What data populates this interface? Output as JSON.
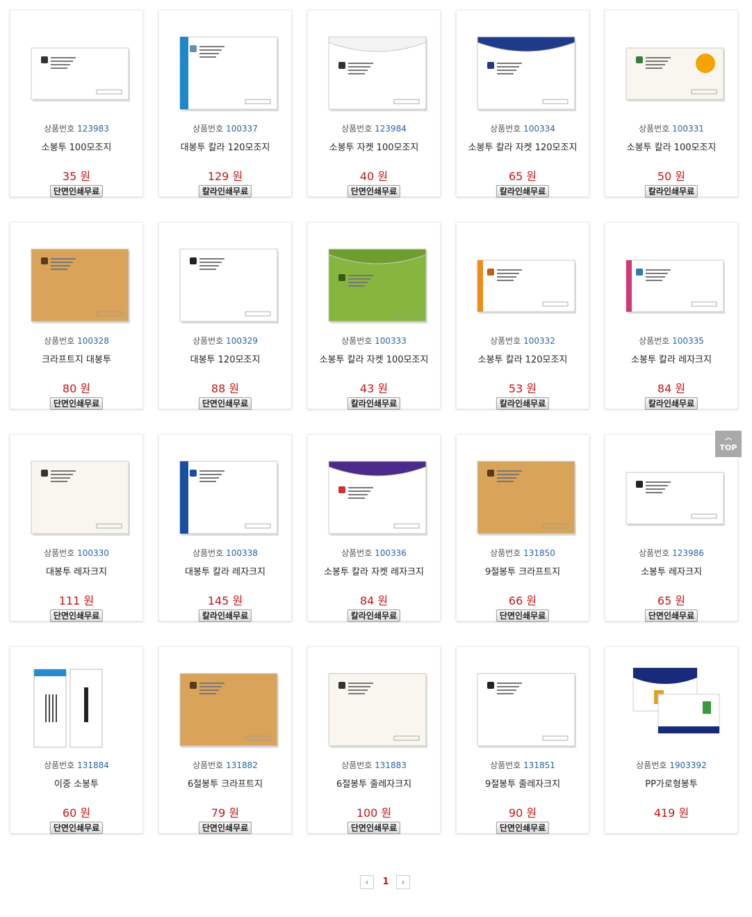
{
  "labels": {
    "product_no": "상품번호",
    "currency": "원"
  },
  "colors": {
    "price": "#c81414",
    "code": "#2a62a8",
    "top_button": "#a9a9a9"
  },
  "products": [
    {
      "code": "123983",
      "name": "소봉투 100모조지",
      "price": "35 원",
      "badge": "단면인쇄무료",
      "thumb": {
        "kind": "white",
        "shape": "small",
        "accent": "#888888",
        "logo": "#333333"
      }
    },
    {
      "code": "100337",
      "name": "대봉투 칼라 120모조지",
      "price": "129 원",
      "badge": "칼라인쇄무료",
      "thumb": {
        "kind": "color",
        "shape": "large",
        "accent": "#1e88c8",
        "logo": "#6b8fa8"
      }
    },
    {
      "code": "123984",
      "name": "소봉투 자켓 100모조지",
      "price": "40 원",
      "badge": "단면인쇄무료",
      "thumb": {
        "kind": "white",
        "shape": "flap",
        "accent": "#888888",
        "logo": "#333333"
      }
    },
    {
      "code": "100334",
      "name": "소봉투 칼라 자켓 120모조지",
      "price": "65 원",
      "badge": "칼라인쇄무료",
      "thumb": {
        "kind": "color",
        "shape": "flap",
        "accent": "#1f3a8a",
        "logo": "#1f3a8a"
      }
    },
    {
      "code": "100331",
      "name": "소봉투 칼라 100모조지",
      "price": "50 원",
      "badge": "칼라인쇄무료",
      "thumb": {
        "kind": "cream",
        "shape": "small",
        "accent": "#f4a300",
        "logo": "#3a7a3a"
      }
    },
    {
      "code": "100328",
      "name": "크라프트지 대봉투",
      "price": "80 원",
      "badge": "단면인쇄무료",
      "thumb": {
        "kind": "kraft",
        "shape": "large",
        "accent": "#a0682a",
        "logo": "#5a3a1a"
      }
    },
    {
      "code": "100329",
      "name": "대봉투 120모조지",
      "price": "88 원",
      "badge": "단면인쇄무료",
      "thumb": {
        "kind": "white",
        "shape": "large",
        "accent": "#888888",
        "logo": "#222222"
      }
    },
    {
      "code": "100333",
      "name": "소봉투 칼라 자켓 100모조지",
      "price": "43 원",
      "badge": "칼라인쇄무료",
      "thumb": {
        "kind": "green",
        "shape": "flap",
        "accent": "#6f9e2e",
        "logo": "#3a5a1a"
      }
    },
    {
      "code": "100332",
      "name": "소봉투 칼라 120모조지",
      "price": "53 원",
      "badge": "칼라인쇄무료",
      "thumb": {
        "kind": "color",
        "shape": "small",
        "accent": "#f08c1a",
        "logo": "#c06010"
      }
    },
    {
      "code": "100335",
      "name": "소봉투 칼라 레자크지",
      "price": "84 원",
      "badge": "칼라인쇄무료",
      "thumb": {
        "kind": "color",
        "shape": "small",
        "accent": "#d03a7a",
        "logo": "#2a7ac0"
      }
    },
    {
      "code": "100330",
      "name": "대봉투 레자크지",
      "price": "111 원",
      "badge": "단면인쇄무료",
      "thumb": {
        "kind": "cream",
        "shape": "large",
        "accent": "#999999",
        "logo": "#333333"
      }
    },
    {
      "code": "100338",
      "name": "대봉투 칼라 레자크지",
      "price": "145 원",
      "badge": "칼라인쇄무료",
      "thumb": {
        "kind": "color",
        "shape": "large",
        "accent": "#1a4fa0",
        "logo": "#1a4fa0"
      }
    },
    {
      "code": "100336",
      "name": "소봉투 칼라 자켓 레자크지",
      "price": "84 원",
      "badge": "칼라인쇄무료",
      "thumb": {
        "kind": "color",
        "shape": "flap",
        "accent": "#4a2a8a",
        "logo": "#d03030"
      }
    },
    {
      "code": "131850",
      "name": "9절봉투 크라프트지",
      "price": "66 원",
      "badge": "단면인쇄무료",
      "thumb": {
        "kind": "kraft",
        "shape": "large",
        "accent": "#a0682a",
        "logo": "#5a3a1a"
      }
    },
    {
      "code": "123986",
      "name": "소봉투 레자크지",
      "price": "65 원",
      "badge": "단면인쇄무료",
      "thumb": {
        "kind": "white",
        "shape": "small",
        "accent": "#999999",
        "logo": "#222222"
      }
    },
    {
      "code": "131884",
      "name": "이중 소봉투",
      "price": "60 원",
      "badge": "단면인쇄무료",
      "thumb": {
        "kind": "double",
        "shape": "double",
        "accent": "#2a8ad0",
        "logo": "#222222"
      }
    },
    {
      "code": "131882",
      "name": "6절봉투 크라프트지",
      "price": "79 원",
      "badge": "단면인쇄무료",
      "thumb": {
        "kind": "kraft",
        "shape": "large",
        "accent": "#a0682a",
        "logo": "#5a3a1a"
      }
    },
    {
      "code": "131883",
      "name": "6절봉투 줄레자크지",
      "price": "100 원",
      "badge": "단면인쇄무료",
      "thumb": {
        "kind": "cream",
        "shape": "large",
        "accent": "#999999",
        "logo": "#333333"
      }
    },
    {
      "code": "131851",
      "name": "9절봉투 줄레자크지",
      "price": "90 원",
      "badge": "단면인쇄무료",
      "thumb": {
        "kind": "white",
        "shape": "large",
        "accent": "#999999",
        "logo": "#222222"
      }
    },
    {
      "code": "1903392",
      "name": "PP가로형봉투",
      "price": "419 원",
      "badge": "",
      "thumb": {
        "kind": "pp",
        "shape": "pp",
        "accent": "#1a2a7a",
        "logo": "#e0a020"
      }
    }
  ],
  "top_button": {
    "label": "TOP",
    "icon": "chevron-up-icon"
  },
  "pagination": {
    "current": "1",
    "prev_icon": "chevron-left-icon",
    "next_icon": "chevron-right-icon"
  }
}
